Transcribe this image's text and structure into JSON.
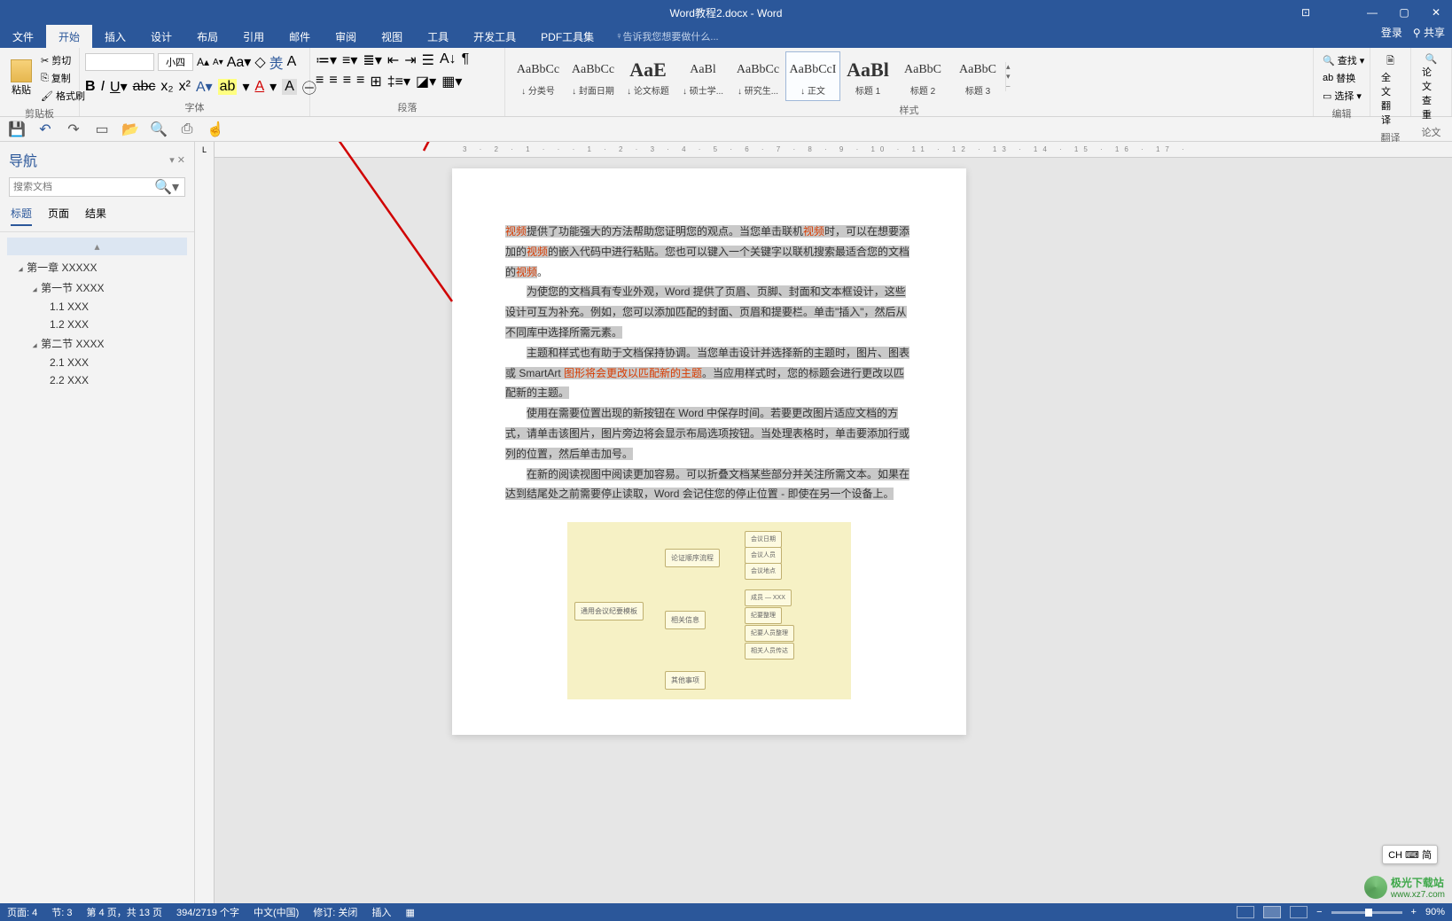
{
  "title": {
    "filename": "Word教程2.docx",
    "appname": "Word"
  },
  "window_controls": {
    "store": "⊞",
    "minimize": "—",
    "maximize": "▢",
    "close": "✕"
  },
  "account": {
    "login": "登录",
    "share": "共享"
  },
  "tabs": [
    "文件",
    "开始",
    "插入",
    "设计",
    "布局",
    "引用",
    "邮件",
    "审阅",
    "视图",
    "工具",
    "开发工具",
    "PDF工具集"
  ],
  "active_tab": "开始",
  "tell_me": "告诉我您想要做什么...",
  "ribbon": {
    "clipboard": {
      "paste": "粘贴",
      "cut": "剪切",
      "copy": "复制",
      "painter": "格式刷",
      "label": "剪贴板"
    },
    "font": {
      "family_placeholder": "",
      "size": "小四",
      "label": "字体"
    },
    "paragraph": {
      "label": "段落"
    },
    "styles": {
      "label": "样式",
      "items": [
        {
          "prev": "AaBbCc",
          "name": "↓ 分类号"
        },
        {
          "prev": "AaBbCc",
          "name": "↓ 封面日期"
        },
        {
          "prev": "AaE",
          "name": "↓ 论文标题",
          "big": true
        },
        {
          "prev": "AaBl",
          "name": "↓ 硕士学..."
        },
        {
          "prev": "AaBbCc",
          "name": "↓ 研究生..."
        },
        {
          "prev": "AaBbCcI",
          "name": "↓ 正文",
          "selected": true
        },
        {
          "prev": "AaBl",
          "name": "标题 1",
          "big": true
        },
        {
          "prev": "AaBbC",
          "name": "标题 2"
        },
        {
          "prev": "AaBbC",
          "name": "标题 3"
        }
      ]
    },
    "editing": {
      "find": "查找",
      "replace": "替换",
      "select": "选择",
      "label": "编辑"
    },
    "translate": {
      "line1": "全文",
      "line2": "翻译",
      "label": "翻译"
    },
    "check": {
      "line1": "论文",
      "line2": "查重",
      "label": "论文"
    }
  },
  "nav": {
    "title": "导航",
    "search_placeholder": "搜索文档",
    "tabs": [
      "标题",
      "页面",
      "结果"
    ],
    "tree": [
      {
        "level": 1,
        "text": "第一章 XXXXX",
        "expand": true
      },
      {
        "level": 2,
        "text": "第一节 XXXX",
        "expand": true
      },
      {
        "level": 3,
        "text": "1.1 XXX"
      },
      {
        "level": 3,
        "text": "1.2 XXX"
      },
      {
        "level": 2,
        "text": "第二节 XXXX",
        "expand": true
      },
      {
        "level": 3,
        "text": "2.1 XXX"
      },
      {
        "level": 3,
        "text": "2.2 XXX"
      }
    ]
  },
  "ruler_h": "3 · 2 · 1 · · · 1 · 2 · 3 · 4 · 5 · 6 · 7 · 8 · 9 · 10 · 11 · 12 · 13 · 14 · 15 · 16 · 17 ·",
  "ruler_corner": "L",
  "doc": {
    "p1a": "视频",
    "p1b": "提供了功能强大的方法帮助您证明您的观点。当您单击联机",
    "p1c": "视频",
    "p1d": "时，可以在想要添加的",
    "p1e": "视频",
    "p1f": "的嵌入代码中进行粘贴。您也可以键入一个关键字以联机搜索最适合您的文档的",
    "p1g": "视频",
    "p1h": "。",
    "p2": "为使您的文档具有专业外观，Word 提供了页眉、页脚、封面和文本框设计，这些设计可互为补充。例如，您可以添加匹配的封面、页眉和提要栏。单击\"插入\"，然后从不同库中选择所需元素。",
    "p3a": "主题和样式也有助于文档保持协调。当您单击设计并选择新的主题时，图片、图表或 SmartArt ",
    "p3b": "图形将会更改以匹配新的主题",
    "p3c": "。当应用样式时，您的标题会进行更改以匹配新的主题。",
    "p4": "使用在需要位置出现的新按钮在 Word 中保存时间。若要更改图片适应文档的方式，请单击该图片，图片旁边将会显示布局选项按钮。当处理表格时，单击要添加行或列的位置，然后单击加号。",
    "p5": "在新的阅读视图中阅读更加容易。可以折叠文档某些部分并关注所需文本。如果在达到结尾处之前需要停止读取，Word 会记住您的停止位置 - 即使在另一个设备上。"
  },
  "diagram": {
    "root": "通用会议纪要模板",
    "n1": "论证顺序流程",
    "n1a": "会议日期",
    "n1b": "会议人员",
    "n1c": "会议地点",
    "n2": "相关信息",
    "n2a": "成员 — XXX",
    "n2b": "纪要整理",
    "n2c": "纪要人员整理",
    "n2d": "相关人员传达",
    "n3": "其他事项"
  },
  "ime": "CH ⌨ 简",
  "status": {
    "page": "页面: 4",
    "section": "节: 3",
    "pageof": "第 4 页，共 13 页",
    "words": "394/2719 个字",
    "lang": "中文(中国)",
    "track": "修订: 关闭",
    "insert": "插入",
    "zoom": "90%"
  },
  "watermark": {
    "site": "极光下载站",
    "url": "www.xz7.com"
  }
}
